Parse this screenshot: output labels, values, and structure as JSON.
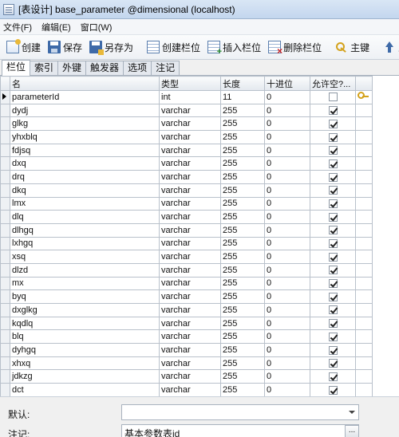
{
  "window": {
    "title": "[表设计] base_parameter @dimensional (localhost)"
  },
  "menu": {
    "items": [
      "文件(F)",
      "编辑(E)",
      "窗口(W)"
    ]
  },
  "toolbar": {
    "create": "创建",
    "save": "保存",
    "save_as": "另存为",
    "create_column": "创建栏位",
    "insert_column": "插入栏位",
    "delete_column": "删除栏位",
    "primary_key": "主键",
    "move_up": "上移"
  },
  "tabs": [
    "栏位",
    "索引",
    "外键",
    "触发器",
    "选项",
    "注记"
  ],
  "grid": {
    "headers": {
      "name": "名",
      "type": "类型",
      "length": "长度",
      "decimals": "十进位",
      "nullable": "允许空?..."
    },
    "rows": [
      {
        "name": "parameterId",
        "type": "int",
        "length": "11",
        "decimals": "0",
        "nullable": false,
        "primary_key": true
      },
      {
        "name": "dydj",
        "type": "varchar",
        "length": "255",
        "decimals": "0",
        "nullable": true
      },
      {
        "name": "glkg",
        "type": "varchar",
        "length": "255",
        "decimals": "0",
        "nullable": true
      },
      {
        "name": "yhxblq",
        "type": "varchar",
        "length": "255",
        "decimals": "0",
        "nullable": true
      },
      {
        "name": "fdjsq",
        "type": "varchar",
        "length": "255",
        "decimals": "0",
        "nullable": true
      },
      {
        "name": "dxq",
        "type": "varchar",
        "length": "255",
        "decimals": "0",
        "nullable": true
      },
      {
        "name": "drq",
        "type": "varchar",
        "length": "255",
        "decimals": "0",
        "nullable": true
      },
      {
        "name": "dkq",
        "type": "varchar",
        "length": "255",
        "decimals": "0",
        "nullable": true
      },
      {
        "name": "lmx",
        "type": "varchar",
        "length": "255",
        "decimals": "0",
        "nullable": true
      },
      {
        "name": "dlq",
        "type": "varchar",
        "length": "255",
        "decimals": "0",
        "nullable": true
      },
      {
        "name": "dlhgq",
        "type": "varchar",
        "length": "255",
        "decimals": "0",
        "nullable": true
      },
      {
        "name": "lxhgq",
        "type": "varchar",
        "length": "255",
        "decimals": "0",
        "nullable": true
      },
      {
        "name": "xsq",
        "type": "varchar",
        "length": "255",
        "decimals": "0",
        "nullable": true
      },
      {
        "name": "dlzd",
        "type": "varchar",
        "length": "255",
        "decimals": "0",
        "nullable": true
      },
      {
        "name": "mx",
        "type": "varchar",
        "length": "255",
        "decimals": "0",
        "nullable": true
      },
      {
        "name": "byq",
        "type": "varchar",
        "length": "255",
        "decimals": "0",
        "nullable": true
      },
      {
        "name": "dxglkg",
        "type": "varchar",
        "length": "255",
        "decimals": "0",
        "nullable": true
      },
      {
        "name": "kqdlq",
        "type": "varchar",
        "length": "255",
        "decimals": "0",
        "nullable": true
      },
      {
        "name": "blq",
        "type": "varchar",
        "length": "255",
        "decimals": "0",
        "nullable": true
      },
      {
        "name": "dyhgq",
        "type": "varchar",
        "length": "255",
        "decimals": "0",
        "nullable": true
      },
      {
        "name": "xhxq",
        "type": "varchar",
        "length": "255",
        "decimals": "0",
        "nullable": true
      },
      {
        "name": "jdkzg",
        "type": "varchar",
        "length": "255",
        "decimals": "0",
        "nullable": true
      },
      {
        "name": "dct",
        "type": "varchar",
        "length": "255",
        "decimals": "0",
        "nullable": true
      }
    ]
  },
  "properties": {
    "default_label": "默认:",
    "default_value": "",
    "comment_label": "注记:",
    "comment_value": "基本参数表id",
    "ellipsis": "..."
  }
}
